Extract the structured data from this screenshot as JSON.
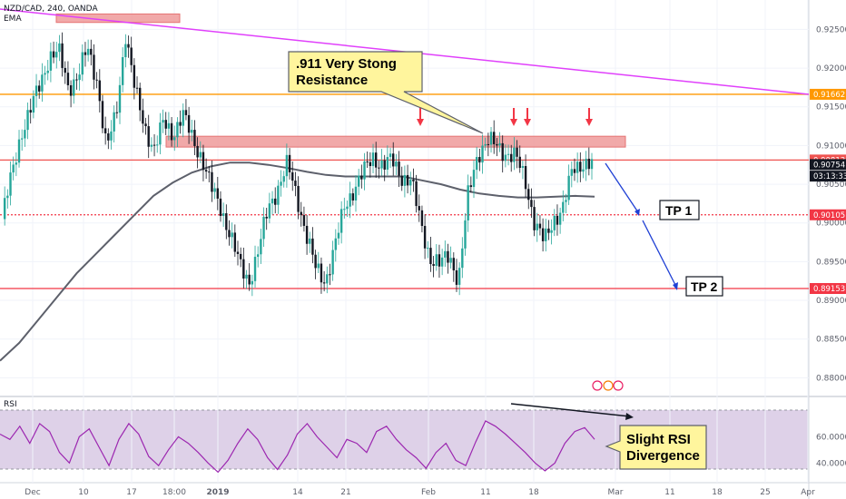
{
  "header": {
    "symbol": "NZD/CAD, 240, OANDA",
    "indicator": "EMA",
    "rsi_label": "RSI"
  },
  "chart_data": {
    "type": "candlestick",
    "interval": "240",
    "price_axis": {
      "ylim": [
        0.8777,
        0.9288
      ],
      "ticks": [
        "0.92500",
        "0.92000",
        "0.91500",
        "0.91000",
        "0.90500",
        "0.90000",
        "0.89500",
        "0.89000",
        "0.88500",
        "0.88000"
      ],
      "tick_values": [
        0.925,
        0.92,
        0.915,
        0.91,
        0.905,
        0.9,
        0.895,
        0.89,
        0.885,
        0.88
      ]
    },
    "rsi_axis": {
      "ylim": [
        25,
        90
      ],
      "ticks": [
        "60.0000",
        "40.0000"
      ],
      "tick_values": [
        60,
        40
      ],
      "bands": [
        70,
        30
      ]
    },
    "time_axis": {
      "labels": [
        "Dec",
        "10",
        "17",
        "18:00",
        "2019",
        "14",
        "21",
        "Feb",
        "11",
        "18",
        "Mar",
        "11",
        "18",
        "25",
        "Apr"
      ],
      "bold": [
        "2019"
      ]
    },
    "price_levels": [
      {
        "label": "0.91662",
        "value": 0.91662,
        "color": "#ff9800",
        "style": "solid"
      },
      {
        "label": "0.90813",
        "value": 0.90813,
        "color": "#ef5350",
        "style": "solid"
      },
      {
        "label": "0.90754",
        "value": 0.90754,
        "color": "#131722",
        "style": "none"
      },
      {
        "label": "03:13:33",
        "value": 0.90605,
        "color": "#131722",
        "style": "none"
      },
      {
        "label": "0.90105",
        "value": 0.90105,
        "color": "#f23645",
        "style": "dotted"
      },
      {
        "label": "0.89153",
        "value": 0.89153,
        "color": "#f23645",
        "style": "solid"
      }
    ],
    "price_series": [
      0.9005,
      0.906,
      0.9115,
      0.9145,
      0.918,
      0.9215,
      0.922,
      0.9175,
      0.919,
      0.9225,
      0.9185,
      0.9095,
      0.914,
      0.9245,
      0.917,
      0.9125,
      0.9095,
      0.913,
      0.9115,
      0.914,
      0.911,
      0.9085,
      0.9045,
      0.902,
      0.8985,
      0.8945,
      0.8925,
      0.8965,
      0.902,
      0.9045,
      0.9075,
      0.9035,
      0.8985,
      0.894,
      0.8925,
      0.897,
      0.902,
      0.9045,
      0.9065,
      0.9085,
      0.9075,
      0.908,
      0.906,
      0.9055,
      0.9,
      0.8955,
      0.8945,
      0.896,
      0.8925,
      0.9035,
      0.909,
      0.9105,
      0.91,
      0.909,
      0.9085,
      0.9055,
      0.9,
      0.8975,
      0.9005,
      0.902,
      0.907,
      0.9078,
      0.9075
    ],
    "ema_series": [
      0.8822,
      0.8845,
      0.8875,
      0.8905,
      0.8935,
      0.896,
      0.8985,
      0.901,
      0.9035,
      0.9052,
      0.9065,
      0.9073,
      0.9078,
      0.9078,
      0.9075,
      0.9071,
      0.9066,
      0.9062,
      0.906,
      0.906,
      0.906,
      0.906,
      0.9055,
      0.905,
      0.9043,
      0.9038,
      0.9035,
      0.9033,
      0.9033,
      0.9034,
      0.9035,
      0.9034
    ],
    "rsi_series": [
      62,
      58,
      68,
      55,
      70,
      64,
      48,
      40,
      60,
      66,
      52,
      38,
      58,
      70,
      62,
      45,
      38,
      50,
      60,
      55,
      48,
      40,
      33,
      42,
      55,
      66,
      58,
      44,
      35,
      46,
      62,
      70,
      60,
      52,
      44,
      58,
      55,
      48,
      64,
      68,
      58,
      50,
      44,
      36,
      48,
      55,
      42,
      38,
      56,
      72,
      68,
      62,
      55,
      48,
      40,
      34,
      40,
      55,
      64,
      67,
      58
    ],
    "resistance_zone": {
      "low": 0.9098,
      "high": 0.9112
    },
    "annotations": {
      "callout": [
        ".911 Very Stong",
        "Resistance"
      ],
      "tp1": "TP 1",
      "tp2": "TP 2",
      "rsi_note": [
        "Slight RSI",
        "Divergence"
      ]
    },
    "colors": {
      "up": "#26a69a",
      "down": "#131722",
      "ema": "#5d606b",
      "trendline": "#e040fb",
      "zone": "#ef9a9a",
      "rsi": "#9c27b0",
      "callout": "#fff59d",
      "arrow_red": "#f23645",
      "arrow_blue": "#1e3fd4"
    }
  }
}
